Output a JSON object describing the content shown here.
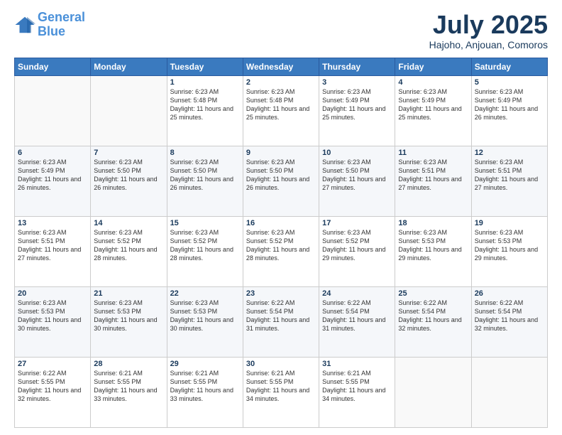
{
  "header": {
    "logo_line1": "General",
    "logo_line2": "Blue",
    "title": "July 2025",
    "subtitle": "Hajoho, Anjouan, Comoros"
  },
  "weekdays": [
    "Sunday",
    "Monday",
    "Tuesday",
    "Wednesday",
    "Thursday",
    "Friday",
    "Saturday"
  ],
  "weeks": [
    [
      {
        "day": "",
        "info": ""
      },
      {
        "day": "",
        "info": ""
      },
      {
        "day": "1",
        "info": "Sunrise: 6:23 AM\nSunset: 5:48 PM\nDaylight: 11 hours and 25 minutes."
      },
      {
        "day": "2",
        "info": "Sunrise: 6:23 AM\nSunset: 5:48 PM\nDaylight: 11 hours and 25 minutes."
      },
      {
        "day": "3",
        "info": "Sunrise: 6:23 AM\nSunset: 5:49 PM\nDaylight: 11 hours and 25 minutes."
      },
      {
        "day": "4",
        "info": "Sunrise: 6:23 AM\nSunset: 5:49 PM\nDaylight: 11 hours and 25 minutes."
      },
      {
        "day": "5",
        "info": "Sunrise: 6:23 AM\nSunset: 5:49 PM\nDaylight: 11 hours and 26 minutes."
      }
    ],
    [
      {
        "day": "6",
        "info": "Sunrise: 6:23 AM\nSunset: 5:49 PM\nDaylight: 11 hours and 26 minutes."
      },
      {
        "day": "7",
        "info": "Sunrise: 6:23 AM\nSunset: 5:50 PM\nDaylight: 11 hours and 26 minutes."
      },
      {
        "day": "8",
        "info": "Sunrise: 6:23 AM\nSunset: 5:50 PM\nDaylight: 11 hours and 26 minutes."
      },
      {
        "day": "9",
        "info": "Sunrise: 6:23 AM\nSunset: 5:50 PM\nDaylight: 11 hours and 26 minutes."
      },
      {
        "day": "10",
        "info": "Sunrise: 6:23 AM\nSunset: 5:50 PM\nDaylight: 11 hours and 27 minutes."
      },
      {
        "day": "11",
        "info": "Sunrise: 6:23 AM\nSunset: 5:51 PM\nDaylight: 11 hours and 27 minutes."
      },
      {
        "day": "12",
        "info": "Sunrise: 6:23 AM\nSunset: 5:51 PM\nDaylight: 11 hours and 27 minutes."
      }
    ],
    [
      {
        "day": "13",
        "info": "Sunrise: 6:23 AM\nSunset: 5:51 PM\nDaylight: 11 hours and 27 minutes."
      },
      {
        "day": "14",
        "info": "Sunrise: 6:23 AM\nSunset: 5:52 PM\nDaylight: 11 hours and 28 minutes."
      },
      {
        "day": "15",
        "info": "Sunrise: 6:23 AM\nSunset: 5:52 PM\nDaylight: 11 hours and 28 minutes."
      },
      {
        "day": "16",
        "info": "Sunrise: 6:23 AM\nSunset: 5:52 PM\nDaylight: 11 hours and 28 minutes."
      },
      {
        "day": "17",
        "info": "Sunrise: 6:23 AM\nSunset: 5:52 PM\nDaylight: 11 hours and 29 minutes."
      },
      {
        "day": "18",
        "info": "Sunrise: 6:23 AM\nSunset: 5:53 PM\nDaylight: 11 hours and 29 minutes."
      },
      {
        "day": "19",
        "info": "Sunrise: 6:23 AM\nSunset: 5:53 PM\nDaylight: 11 hours and 29 minutes."
      }
    ],
    [
      {
        "day": "20",
        "info": "Sunrise: 6:23 AM\nSunset: 5:53 PM\nDaylight: 11 hours and 30 minutes."
      },
      {
        "day": "21",
        "info": "Sunrise: 6:23 AM\nSunset: 5:53 PM\nDaylight: 11 hours and 30 minutes."
      },
      {
        "day": "22",
        "info": "Sunrise: 6:23 AM\nSunset: 5:53 PM\nDaylight: 11 hours and 30 minutes."
      },
      {
        "day": "23",
        "info": "Sunrise: 6:22 AM\nSunset: 5:54 PM\nDaylight: 11 hours and 31 minutes."
      },
      {
        "day": "24",
        "info": "Sunrise: 6:22 AM\nSunset: 5:54 PM\nDaylight: 11 hours and 31 minutes."
      },
      {
        "day": "25",
        "info": "Sunrise: 6:22 AM\nSunset: 5:54 PM\nDaylight: 11 hours and 32 minutes."
      },
      {
        "day": "26",
        "info": "Sunrise: 6:22 AM\nSunset: 5:54 PM\nDaylight: 11 hours and 32 minutes."
      }
    ],
    [
      {
        "day": "27",
        "info": "Sunrise: 6:22 AM\nSunset: 5:55 PM\nDaylight: 11 hours and 32 minutes."
      },
      {
        "day": "28",
        "info": "Sunrise: 6:21 AM\nSunset: 5:55 PM\nDaylight: 11 hours and 33 minutes."
      },
      {
        "day": "29",
        "info": "Sunrise: 6:21 AM\nSunset: 5:55 PM\nDaylight: 11 hours and 33 minutes."
      },
      {
        "day": "30",
        "info": "Sunrise: 6:21 AM\nSunset: 5:55 PM\nDaylight: 11 hours and 34 minutes."
      },
      {
        "day": "31",
        "info": "Sunrise: 6:21 AM\nSunset: 5:55 PM\nDaylight: 11 hours and 34 minutes."
      },
      {
        "day": "",
        "info": ""
      },
      {
        "day": "",
        "info": ""
      }
    ]
  ]
}
